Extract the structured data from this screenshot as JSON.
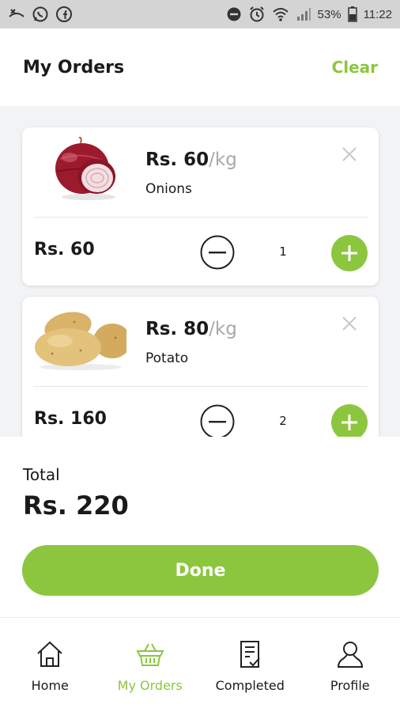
{
  "status_bar": {
    "battery": "53%",
    "time": "11:22",
    "icons": [
      "missed-call-icon",
      "whatsapp-icon",
      "facebook-icon",
      "do-not-disturb-icon",
      "alarm-icon",
      "wifi-icon",
      "signal-icon",
      "battery-icon"
    ]
  },
  "header": {
    "title": "My Orders",
    "clear_label": "Clear"
  },
  "orders": [
    {
      "price": "Rs. 60",
      "unit": "/kg",
      "name": "Onions",
      "subtotal": "Rs. 60",
      "quantity": "1",
      "image_icon": "onion-image"
    },
    {
      "price": "Rs. 80",
      "unit": "/kg",
      "name": "Potato",
      "subtotal": "Rs. 160",
      "quantity": "2",
      "image_icon": "potato-image"
    }
  ],
  "summary": {
    "total_label": "Total",
    "total_value": "Rs. 220",
    "done_label": "Done"
  },
  "nav": {
    "items": [
      {
        "label": "Home",
        "icon": "home-icon",
        "active": false
      },
      {
        "label": "My Orders",
        "icon": "basket-icon",
        "active": true
      },
      {
        "label": "Completed",
        "icon": "checklist-icon",
        "active": false
      },
      {
        "label": "Profile",
        "icon": "user-icon",
        "active": false
      }
    ]
  },
  "colors": {
    "accent": "#8cc63f",
    "status_bar": "#d4d4d4",
    "content_bg": "#f2f3f5",
    "unit_gray": "#a8a8a8"
  }
}
